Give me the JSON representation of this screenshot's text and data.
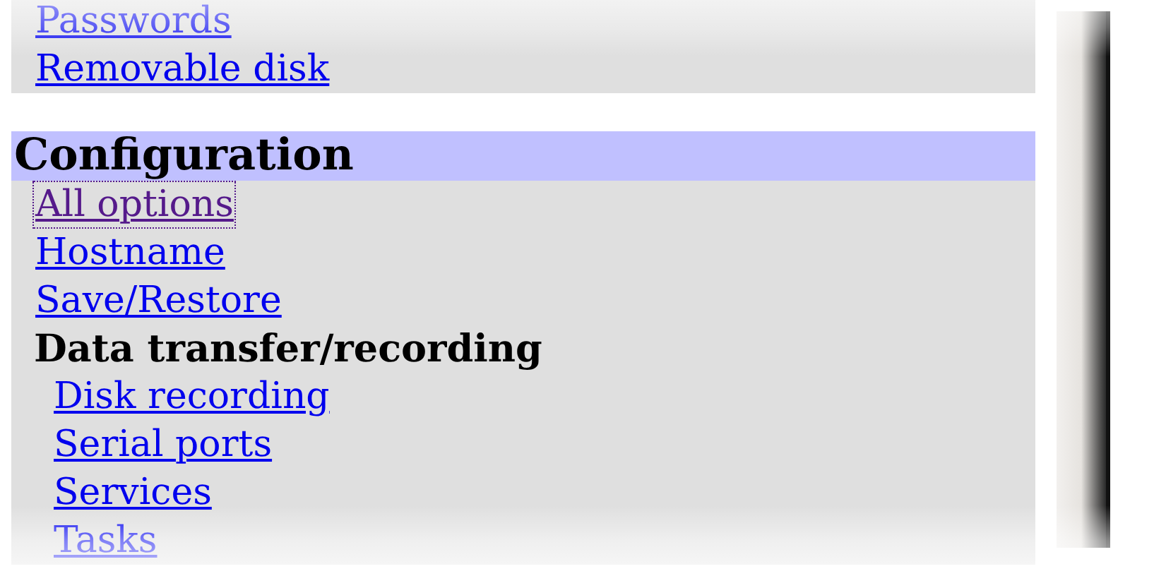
{
  "sections": [
    {
      "items": [
        {
          "kind": "link",
          "label": "Passwords",
          "visited": false,
          "focused": false
        },
        {
          "kind": "link",
          "label": "Removable disk",
          "visited": false,
          "focused": false
        }
      ]
    },
    {
      "title": "Configuration",
      "items": [
        {
          "kind": "link",
          "label": "All options",
          "visited": true,
          "focused": true
        },
        {
          "kind": "link",
          "label": "Hostname",
          "visited": false,
          "focused": false
        },
        {
          "kind": "link",
          "label": "Save/Restore",
          "visited": false,
          "focused": false
        },
        {
          "kind": "heading",
          "label": "Data transfer/recording",
          "children": [
            {
              "kind": "link",
              "label": "Disk recording",
              "visited": false,
              "focused": false
            },
            {
              "kind": "link",
              "label": "Serial ports",
              "visited": false,
              "focused": false
            },
            {
              "kind": "link",
              "label": "Services",
              "visited": false,
              "focused": false
            },
            {
              "kind": "link",
              "label": "Tasks",
              "visited": false,
              "focused": false
            }
          ]
        }
      ]
    }
  ]
}
